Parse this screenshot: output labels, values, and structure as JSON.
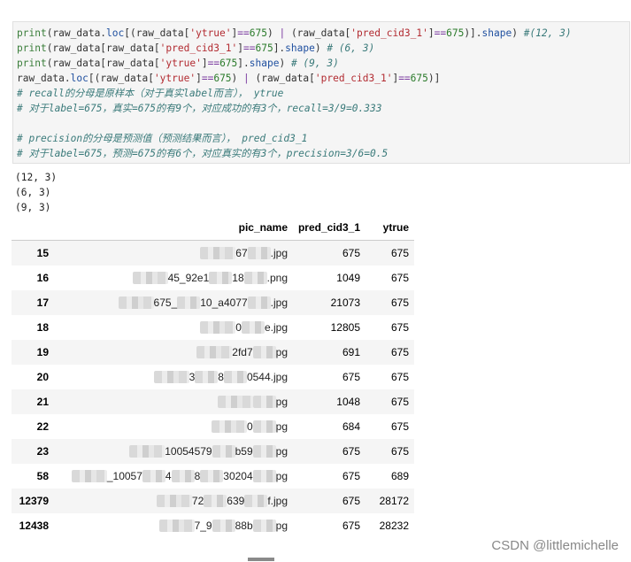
{
  "code_lines": [
    "print(raw_data.loc[(raw_data['ytrue']==675) | (raw_data['pred_cid3_1']==675)].shape) #(12, 3)",
    "print(raw_data[raw_data['pred_cid3_1']==675].shape) # (6, 3)",
    "print(raw_data[raw_data['ytrue']==675].shape) # (9, 3)",
    "raw_data.loc[(raw_data['ytrue']==675) | (raw_data['pred_cid3_1']==675)]",
    "# recall的分母是原样本（对于真实label而言）， ytrue",
    "# 对于label=675，真实=675的有9个，对应成功的有3个，recall=3/9=0.333",
    "",
    "# precision的分母是预测值（预测结果而言）， pred_cid3_1",
    "# 对于label=675，预测=675的有6个，对应真实的有3个，precision=3/6=0.5"
  ],
  "output_lines": [
    "(12, 3)",
    "(6, 3)",
    "(9, 3)"
  ],
  "table": {
    "columns": [
      "",
      "pic_name",
      "pred_cid3_1",
      "ytrue"
    ],
    "rows": [
      {
        "index": "15",
        "pic_visible": [
          "67",
          ".jpg"
        ],
        "pred": "675",
        "ytrue": "675"
      },
      {
        "index": "16",
        "pic_visible": [
          "45_92e1",
          "18",
          ".png"
        ],
        "pred": "1049",
        "ytrue": "675"
      },
      {
        "index": "17",
        "pic_visible": [
          "675_",
          "10_a4077",
          ".jpg"
        ],
        "pred": "21073",
        "ytrue": "675"
      },
      {
        "index": "18",
        "pic_visible": [
          "0",
          "e.jpg"
        ],
        "pred": "12805",
        "ytrue": "675"
      },
      {
        "index": "19",
        "pic_visible": [
          "2fd7",
          "pg"
        ],
        "pred": "691",
        "ytrue": "675"
      },
      {
        "index": "20",
        "pic_visible": [
          "3",
          "8",
          "0544.jpg"
        ],
        "pred": "675",
        "ytrue": "675"
      },
      {
        "index": "21",
        "pic_visible": [
          "",
          "pg"
        ],
        "pred": "1048",
        "ytrue": "675"
      },
      {
        "index": "22",
        "pic_visible": [
          "0",
          "pg"
        ],
        "pred": "684",
        "ytrue": "675"
      },
      {
        "index": "23",
        "pic_visible": [
          "10054579",
          "b59",
          "pg"
        ],
        "pred": "675",
        "ytrue": "675"
      },
      {
        "index": "58",
        "pic_visible": [
          "_10057",
          "4",
          "8",
          "30204",
          "pg"
        ],
        "pred": "675",
        "ytrue": "689"
      },
      {
        "index": "12379",
        "pic_visible": [
          "72",
          "639",
          "f.jpg"
        ],
        "pred": "675",
        "ytrue": "28172"
      },
      {
        "index": "12438",
        "pic_visible": [
          "7_9",
          "88b",
          "pg"
        ],
        "pred": "675",
        "ytrue": "28232"
      }
    ]
  },
  "watermark": "CSDN @littlemichelle"
}
